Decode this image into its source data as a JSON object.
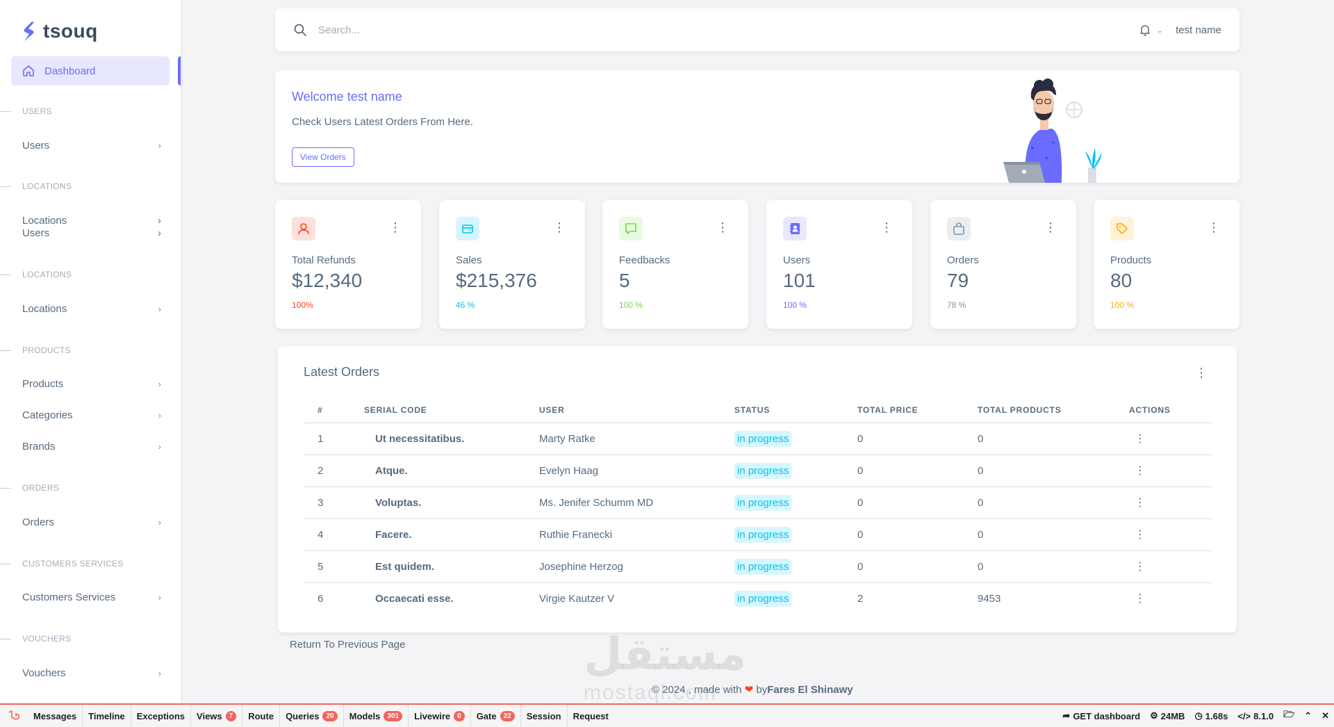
{
  "brand": {
    "name": "tsouq"
  },
  "sidebar": {
    "active": "Dashboard",
    "sections": [
      {
        "label": "USERS"
      },
      {
        "label": "LOCATIONS"
      },
      {
        "label": "LOCATIONS"
      },
      {
        "label": "PRODUCTS"
      },
      {
        "label": "ORDERS"
      },
      {
        "label": "CUSTOMERS SERVICES"
      },
      {
        "label": "VOUCHERS"
      }
    ],
    "items": {
      "users": "Users",
      "locations_a": "Locations",
      "locations_users": "Users",
      "locations_b": "Locations",
      "products": "Products",
      "categories": "Categories",
      "brands": "Brands",
      "orders": "Orders",
      "customers_services": "Customers Services",
      "vouchers": "Vouchers"
    },
    "chevron": "›"
  },
  "topbar": {
    "search_placeholder": "Search...",
    "user_name": "test name"
  },
  "welcome": {
    "title": "Welcome test name",
    "subtitle": "Check Users Latest Orders From Here.",
    "button": "View Orders"
  },
  "stats": [
    {
      "label": "Total Refunds",
      "value": "$12,340",
      "pct": "100%",
      "color": "#ff3e1d",
      "bg": "#ffe0db",
      "icon": "user-icon"
    },
    {
      "label": "Sales",
      "value": "$215,376",
      "pct": "46 %",
      "color": "#03c3ec",
      "bg": "#d7f5fc",
      "icon": "wallet-icon"
    },
    {
      "label": "Feedbacks",
      "value": "5",
      "pct": "100 %",
      "color": "#71dd37",
      "bg": "#e8fadf",
      "icon": "message-icon"
    },
    {
      "label": "Users",
      "value": "101",
      "pct": "100 %",
      "color": "#696cff",
      "bg": "#e7e7ff",
      "icon": "contact-book-icon"
    },
    {
      "label": "Orders",
      "value": "79",
      "pct": "78 %",
      "color": "#8592a3",
      "bg": "#ebeef0",
      "icon": "shopping-bag-icon"
    },
    {
      "label": "Products",
      "value": "80",
      "pct": "100 %",
      "color": "#ffab00",
      "bg": "#fff2d6",
      "icon": "tag-icon"
    }
  ],
  "orders": {
    "title": "Latest Orders",
    "columns": [
      "#",
      "SERIAL CODE",
      "USER",
      "STATUS",
      "TOTAL PRICE",
      "TOTAL PRODUCTS",
      "ACTIONS"
    ],
    "rows": [
      {
        "n": "1",
        "serial": "Ut necessitatibus.",
        "user": "Marty Ratke",
        "status": "in progress",
        "price": "0",
        "products": "0"
      },
      {
        "n": "2",
        "serial": "Atque.",
        "user": "Evelyn Haag",
        "status": "in progress",
        "price": "0",
        "products": "0"
      },
      {
        "n": "3",
        "serial": "Voluptas.",
        "user": "Ms. Jenifer Schumm MD",
        "status": "in progress",
        "price": "0",
        "products": "0"
      },
      {
        "n": "4",
        "serial": "Facere.",
        "user": "Ruthie Franecki",
        "status": "in progress",
        "price": "0",
        "products": "0"
      },
      {
        "n": "5",
        "serial": "Est quidem.",
        "user": "Josephine Herzog",
        "status": "in progress",
        "price": "0",
        "products": "0"
      },
      {
        "n": "6",
        "serial": "Occaecati esse.",
        "user": "Virgie Kautzer V",
        "status": "in progress",
        "price": "2",
        "products": "9453"
      }
    ]
  },
  "return_link": "Return To Previous Page",
  "footer": {
    "prefix": "© 2024 , made with",
    "by": "by",
    "author": "Fares El Shinawy"
  },
  "watermark": {
    "arabic": "مستقل",
    "latin": "mostaql.com"
  },
  "debugbar": {
    "tabs": [
      {
        "label": "Messages"
      },
      {
        "label": "Timeline"
      },
      {
        "label": "Exceptions"
      },
      {
        "label": "Views",
        "count": "7"
      },
      {
        "label": "Route"
      },
      {
        "label": "Queries",
        "count": "20"
      },
      {
        "label": "Models",
        "count": "301"
      },
      {
        "label": "Livewire",
        "count": "0"
      },
      {
        "label": "Gate",
        "count": "22"
      },
      {
        "label": "Session"
      },
      {
        "label": "Request"
      }
    ],
    "route": "GET dashboard",
    "memory": "24MB",
    "time": "1.68s",
    "php": "8.1.0"
  }
}
